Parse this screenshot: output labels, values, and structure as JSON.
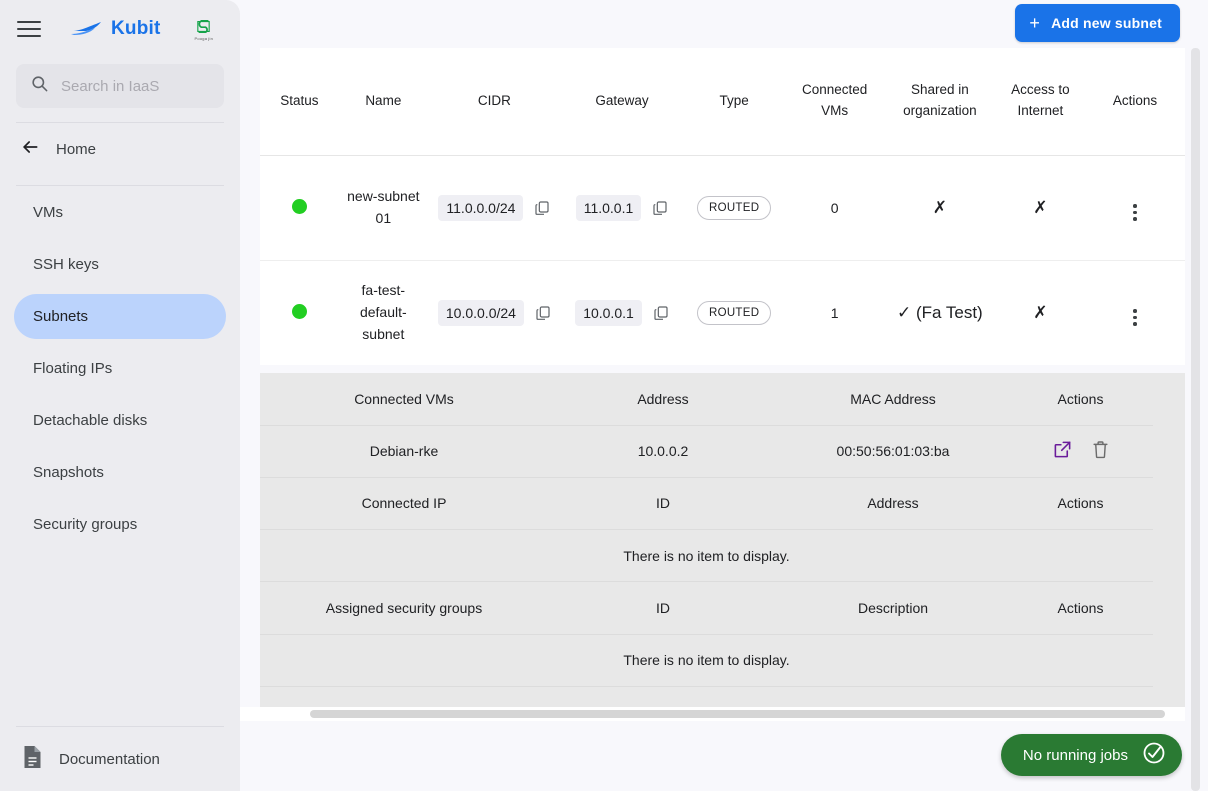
{
  "brand": {
    "name": "Kubit",
    "partner_sub": "Pooga jin"
  },
  "search": {
    "placeholder": "Search in IaaS",
    "value": ""
  },
  "sidebar": {
    "home_label": "Home",
    "items": [
      {
        "label": "VMs",
        "active": false
      },
      {
        "label": "SSH keys",
        "active": false
      },
      {
        "label": "Subnets",
        "active": true
      },
      {
        "label": "Floating IPs",
        "active": false
      },
      {
        "label": "Detachable disks",
        "active": false
      },
      {
        "label": "Snapshots",
        "active": false
      },
      {
        "label": "Security groups",
        "active": false
      }
    ],
    "documentation_label": "Documentation"
  },
  "toolbar": {
    "add_label": "Add new subnet",
    "add_plus": "+"
  },
  "table": {
    "headers": [
      "Status",
      "Name",
      "CIDR",
      "Gateway",
      "Type",
      "Connected VMs",
      "Shared in organization",
      "Access to Internet",
      "Actions"
    ],
    "rows": [
      {
        "status": "up",
        "name": "new-subnet 01",
        "cidr": "11.0.0.0/24",
        "gateway": "11.0.0.1",
        "type": "ROUTED",
        "connected_vms": "0",
        "shared": "✗",
        "internet": "✗"
      },
      {
        "status": "up",
        "name": "fa-test-default-subnet",
        "cidr": "10.0.0.0/24",
        "gateway": "10.0.0.1",
        "type": "ROUTED",
        "connected_vms": "1",
        "shared": "✓ (Fa Test)",
        "internet": "✗"
      }
    ]
  },
  "detail": {
    "connected_vms": {
      "headers": [
        "Connected VMs",
        "Address",
        "MAC Address",
        "Actions"
      ],
      "rows": [
        {
          "name": "Debian-rke",
          "address": "10.0.0.2",
          "mac": "00:50:56:01:03:ba"
        }
      ]
    },
    "connected_ip": {
      "headers": [
        "Connected IP",
        "ID",
        "Address",
        "Actions"
      ],
      "empty": "There is no item to display."
    },
    "security_groups": {
      "headers": [
        "Assigned security groups",
        "ID",
        "Description",
        "Actions"
      ],
      "empty": "There is no item to display."
    }
  },
  "status_bar": {
    "jobs_label": "No running jobs"
  },
  "colors": {
    "accent": "#1a73e8",
    "status_up": "#22CE22",
    "jobs_green": "#2a7a33",
    "nav_active": "#BBD3FC",
    "link_purple": "#6A1B9A"
  }
}
